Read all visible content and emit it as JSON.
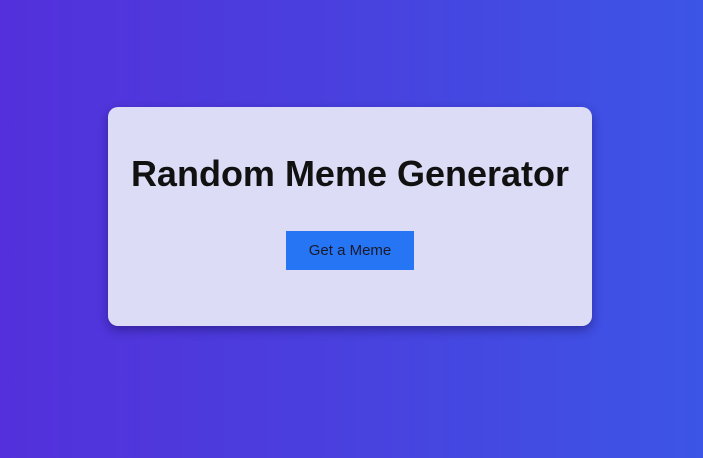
{
  "card": {
    "title": "Random Meme Generator",
    "button_label": "Get a Meme"
  },
  "colors": {
    "background_gradient_start": "#5330db",
    "background_gradient_end": "#3c55e6",
    "card_background": "#dcdcf7",
    "button_background": "#2575f5",
    "title_text": "#111111"
  }
}
